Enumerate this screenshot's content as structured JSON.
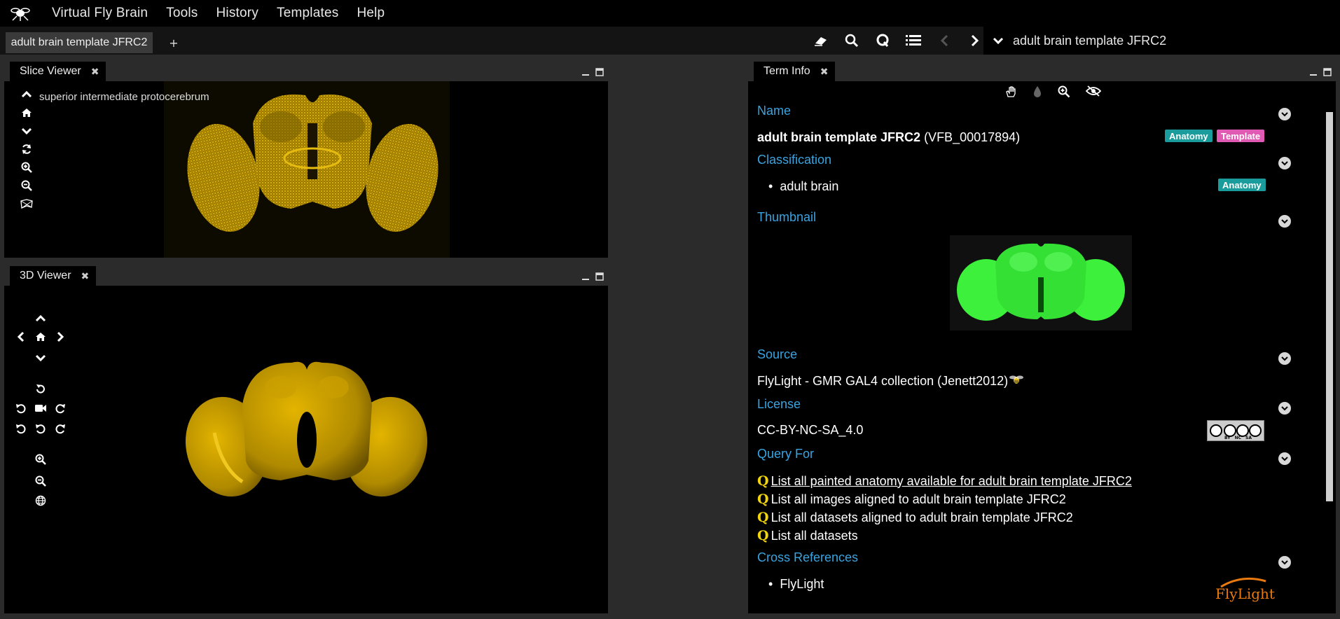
{
  "menubar": {
    "items": [
      "Virtual Fly Brain",
      "Tools",
      "History",
      "Templates",
      "Help"
    ]
  },
  "tabs": {
    "active_label": "adult brain template JFRC2",
    "add_label": "+"
  },
  "template_selector": {
    "value": "adult brain template JFRC2"
  },
  "slice_viewer": {
    "title": "Slice Viewer",
    "close": "✖",
    "region_label": "superior intermediate protocerebrum"
  },
  "viewer_3d": {
    "title": "3D Viewer",
    "close": "✖"
  },
  "term_info": {
    "title": "Term Info",
    "close": "✖",
    "name_heading": "Name",
    "name_bold": "adult brain template JFRC2",
    "name_id": "(VFB_00017894)",
    "name_tags": [
      "Anatomy",
      "Template"
    ],
    "classification_heading": "Classification",
    "classification_item": "adult brain",
    "classification_tag": "Anatomy",
    "thumbnail_heading": "Thumbnail",
    "source_heading": "Source",
    "source_text": "FlyLight - GMR GAL4 collection (Jenett2012)",
    "license_heading": "License",
    "license_text": "CC-BY-NC-SA_4.0",
    "license_badge": [
      "BY",
      "NC",
      "SA"
    ],
    "query_heading": "Query For",
    "query_marker": "Q",
    "queries": [
      "List all painted anatomy available for adult brain template JFRC2",
      "List all images aligned to adult brain template JFRC2",
      "List all datasets aligned to adult brain template JFRC2",
      "List all datasets"
    ],
    "xref_heading": "Cross References",
    "xref_item": "FlyLight",
    "flylight_logo": "FlyLight"
  },
  "colors": {
    "accent_blue": "#3aa3e0",
    "anatomy_badge": "#1a9c9c",
    "template_badge": "#e05ab4",
    "query_yellow": "#f2d40b",
    "brain_gold": "#c9a400",
    "thumbnail_green": "#3cf03c"
  }
}
